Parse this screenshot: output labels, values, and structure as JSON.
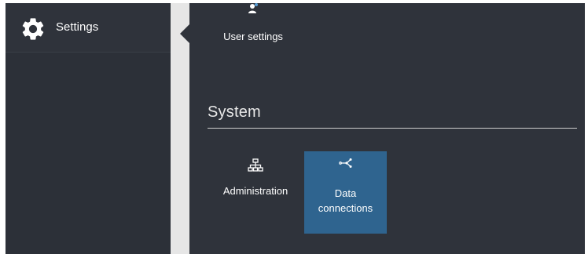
{
  "sidebar": {
    "title": "Settings",
    "icon": "gear-icon"
  },
  "main": {
    "user_settings": {
      "label": "User settings",
      "icon": "user-settings-icon"
    },
    "section": {
      "title": "System"
    },
    "tiles": [
      {
        "label": "Administration",
        "icon": "sitemap-icon",
        "selected": false
      },
      {
        "label_line1": "Data",
        "label_line2": "connections",
        "icon": "share-nodes-icon",
        "selected": true
      }
    ]
  },
  "colors": {
    "background": "#2f333b",
    "sidebar": "#2c3038",
    "selected_tile": "#2f648f",
    "divider": "#e6e6e6",
    "text": "#ffffff"
  }
}
